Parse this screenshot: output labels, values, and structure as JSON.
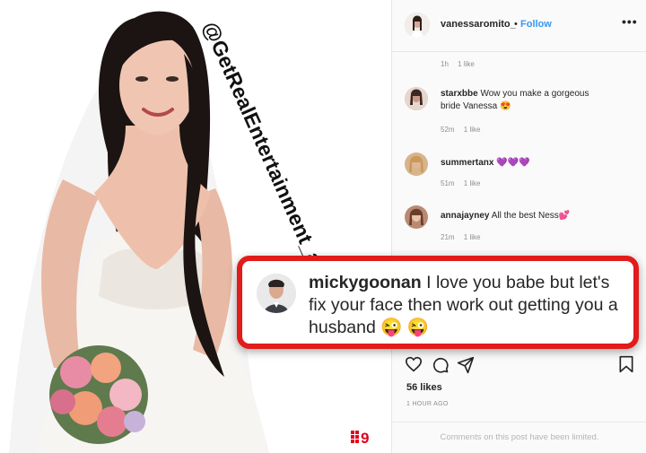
{
  "photo": {
    "watermark": "@GetRealEntertainment_au",
    "channel_logo": "9"
  },
  "post": {
    "username": "vanessaromito_",
    "separator": "•",
    "follow_label": "Follow",
    "more_icon": "more-icon"
  },
  "comments": [
    {
      "username": "",
      "text": "",
      "time": "1h",
      "likes": "1 like"
    },
    {
      "username": "starxbbe",
      "text": "Wow you make a gorgeous bride Vanessa 😍",
      "time": "52m",
      "likes": "1 like"
    },
    {
      "username": "summertanx",
      "text": "💜💜💜",
      "time": "51m",
      "likes": "1 like"
    },
    {
      "username": "annajayney",
      "text": "All the best Ness💕",
      "time": "21m",
      "likes": "1 like"
    }
  ],
  "callout": {
    "username": "mickygoonan",
    "text": "I love you babe but let's fix your face then work out getting you a husband 😜 😜"
  },
  "actions": {
    "likes": "56 likes",
    "time_ago": "1 HOUR AGO",
    "limited": "Comments on this post have been limited."
  },
  "colors": {
    "accent_blue": "#3897f0",
    "callout_border": "#e21b1b"
  }
}
